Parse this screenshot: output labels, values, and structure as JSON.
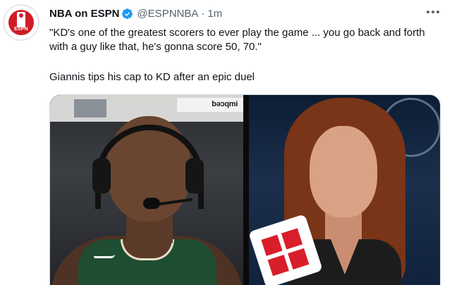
{
  "tweet": {
    "display_name": "NBA on ESPN",
    "verified": true,
    "handle": "@ESPNNBA",
    "separator": "·",
    "time": "1m",
    "text_line_1": "\"KD's one of the greatest scorers to ever play the game ... you go back and forth with a guy like that, he's gonna score 50, 70.\"",
    "text_line_2": "Giannis tips his cap to KD after an epic duel",
    "avatar_text": "ESPN",
    "more_icon": "more-horizontal-icon",
    "media": {
      "left_panel": "player-interview-frame",
      "right_panel": "reporter-frame",
      "sign_text": "bəɔqmi"
    }
  },
  "colors": {
    "verified_blue": "#1d9bf0",
    "secondary_text": "#536471",
    "espn_red": "#cf1c26"
  }
}
